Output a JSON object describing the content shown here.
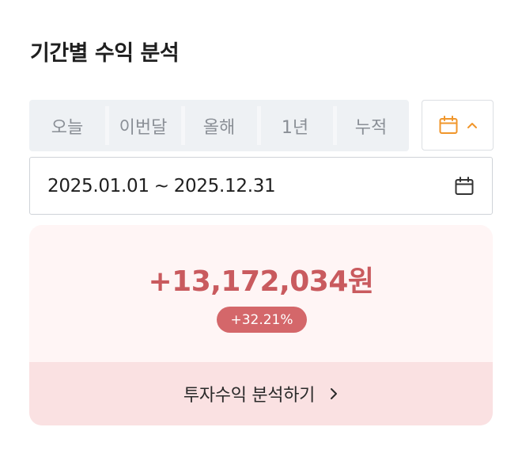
{
  "header": {
    "title": "기간별 수익 분석"
  },
  "period_tabs": [
    {
      "label": "오늘"
    },
    {
      "label": "이번달"
    },
    {
      "label": "올해"
    },
    {
      "label": "1년"
    },
    {
      "label": "누적"
    }
  ],
  "calendar_toggle": {
    "icon": "calendar-icon",
    "chevron_icon": "chevron-up-icon",
    "accent_color": "#f0962b",
    "state": "expanded"
  },
  "date_range": {
    "start": "2025.01.01",
    "separator": "~",
    "end": "2025.12.31",
    "icon": "calendar-icon"
  },
  "summary": {
    "profit_amount": "+13,172,034원",
    "profit_rate": "+32.21%",
    "profit_color": "#c95a5e",
    "badge_color": "#d4676a"
  },
  "analysis_link": {
    "label": "투자수익 분석하기",
    "icon": "chevron-right-icon"
  }
}
